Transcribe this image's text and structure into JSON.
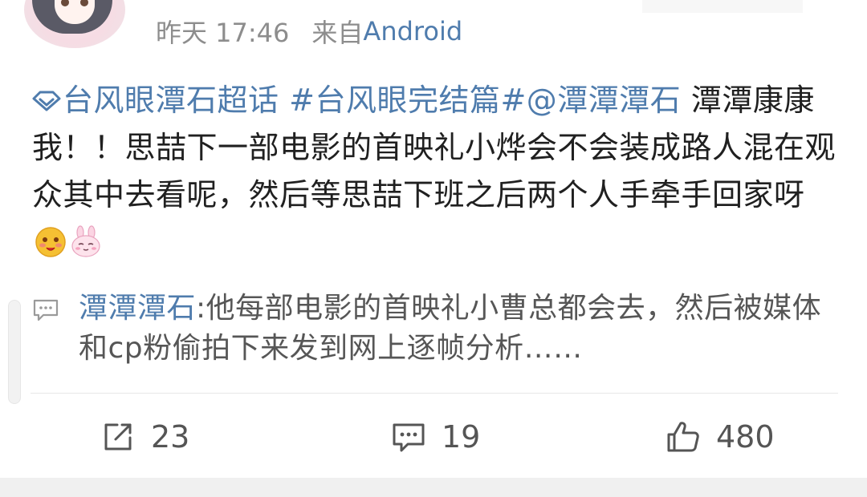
{
  "header": {
    "time": "昨天 17:46",
    "source_prefix": "来自",
    "device": "Android"
  },
  "post": {
    "supertopic": "台风眼潭石超话",
    "hashtag": "#台风眼完结篇#",
    "mention": "@潭潭潭石",
    "body": "潭潭康康我！！思喆下一部电影的首映礼小烨会不会装成路人混在观众其中去看呢，然后等思喆下班之后两个人手牵手回家呀",
    "emojis": [
      "blushing-face-icon",
      "bunny-face-icon"
    ]
  },
  "comment_preview": {
    "author": "潭潭潭石",
    "separator": ":",
    "text": "他每部电影的首映礼小曹总都会去，然后被媒体和cp粉偷拍下来发到网上逐帧分析……"
  },
  "actions": {
    "repost_count": "23",
    "comment_count": "19",
    "like_count": "480"
  },
  "colors": {
    "link": "#4f7cad",
    "meta_gray": "#8d8d8d",
    "body_text": "#202020"
  }
}
